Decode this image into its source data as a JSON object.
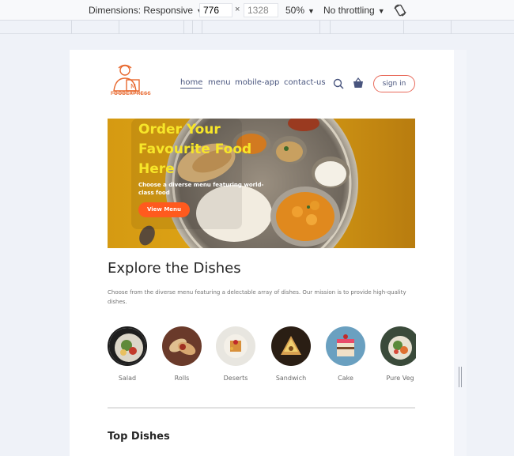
{
  "devtools": {
    "dimensions_label": "Dimensions: Responsive",
    "width": "776",
    "height": "1328",
    "times": "×",
    "zoom": "50%",
    "throttling": "No throttling"
  },
  "site": {
    "logo_text": "FOODEXPRESS",
    "nav": [
      "home",
      "menu",
      "mobile-app",
      "contact-us"
    ],
    "signin_label": "sign in"
  },
  "hero": {
    "title": "Order Your Favourite Food Here",
    "subtitle": "Choose a diverse menu featuring world-class food",
    "button_label": "View Menu"
  },
  "explore": {
    "title": "Explore the Dishes",
    "text": "Choose from the diverse menu featuring a delectable array of dishes. Our mission is to provide high-quality dishes."
  },
  "dishes": [
    {
      "label": "Salad",
      "color": "#5a7d3a"
    },
    {
      "label": "Rolls",
      "color": "#b05a2a"
    },
    {
      "label": "Deserts",
      "color": "#d8903a"
    },
    {
      "label": "Sandwich",
      "color": "#8a5a20"
    },
    {
      "label": "Cake",
      "color": "#4f8aa8"
    },
    {
      "label": "Pure Veg",
      "color": "#6a7a5a"
    }
  ],
  "section": {
    "top_dishes": "Top Dishes"
  },
  "colors": {
    "accent": "#ff5a1e",
    "hero_title": "#f7e629",
    "nav_text": "#49557e"
  }
}
